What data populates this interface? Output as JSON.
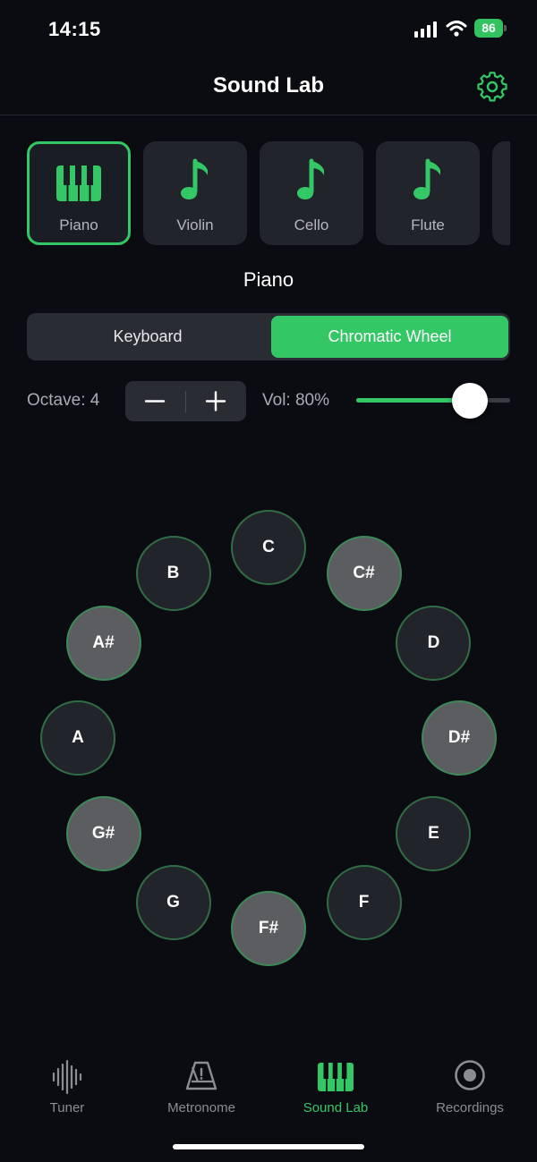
{
  "status": {
    "time": "14:15",
    "battery": "86"
  },
  "header": {
    "title": "Sound Lab"
  },
  "instruments": [
    {
      "label": "Piano",
      "icon": "piano-icon",
      "active": true
    },
    {
      "label": "Violin",
      "icon": "music-note-icon",
      "active": false
    },
    {
      "label": "Cello",
      "icon": "music-note-icon",
      "active": false
    },
    {
      "label": "Flute",
      "icon": "music-note-icon",
      "active": false
    }
  ],
  "selected_instrument": "Piano",
  "mode": {
    "keyboard": "Keyboard",
    "wheel": "Chromatic Wheel",
    "selected": "Chromatic Wheel"
  },
  "octave": {
    "label": "Octave: 4",
    "value": 4
  },
  "volume": {
    "label": "Vol: 80%",
    "value": 0.8
  },
  "wheel_notes": [
    {
      "name": "C",
      "sharp": false
    },
    {
      "name": "C#",
      "sharp": true
    },
    {
      "name": "D",
      "sharp": false
    },
    {
      "name": "D#",
      "sharp": true
    },
    {
      "name": "E",
      "sharp": false
    },
    {
      "name": "F",
      "sharp": false
    },
    {
      "name": "F#",
      "sharp": true
    },
    {
      "name": "G",
      "sharp": false
    },
    {
      "name": "G#",
      "sharp": true
    },
    {
      "name": "A",
      "sharp": false
    },
    {
      "name": "A#",
      "sharp": true
    },
    {
      "name": "B",
      "sharp": false
    }
  ],
  "tabs": [
    {
      "label": "Tuner",
      "icon": "waveform-icon",
      "active": false
    },
    {
      "label": "Metronome",
      "icon": "metronome-icon",
      "active": false
    },
    {
      "label": "Sound Lab",
      "icon": "piano-icon",
      "active": true
    },
    {
      "label": "Recordings",
      "icon": "record-icon",
      "active": false
    }
  ],
  "colors": {
    "accent": "#34c765",
    "background": "#0b0c12",
    "tile": "#22242b",
    "sharp_note": "#5c5d61"
  }
}
